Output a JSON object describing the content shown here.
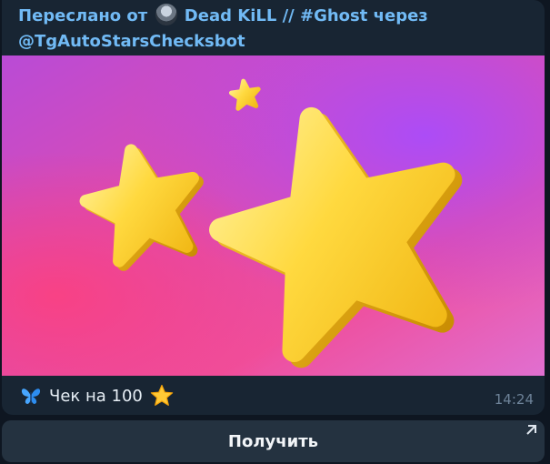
{
  "message": {
    "forward_prefix": "Переслано от",
    "forward_author": "Dead KiLL // #Ghost",
    "forward_via": "через",
    "bot_username": "@TgAutoStarsChecksbot",
    "caption_text": "Чек на 100",
    "time": "14:24",
    "media_icon": "stars-illustration",
    "caption_icons": [
      "butterfly-icon",
      "star-icon"
    ]
  },
  "inline_keyboard": {
    "button_label": "Получить",
    "button_icon": "external-arrow-icon"
  },
  "colors": {
    "bubble_bg": "#182533",
    "link_blue": "#71baf5",
    "button_bg": "#243240",
    "time_gray": "#6d8298"
  }
}
